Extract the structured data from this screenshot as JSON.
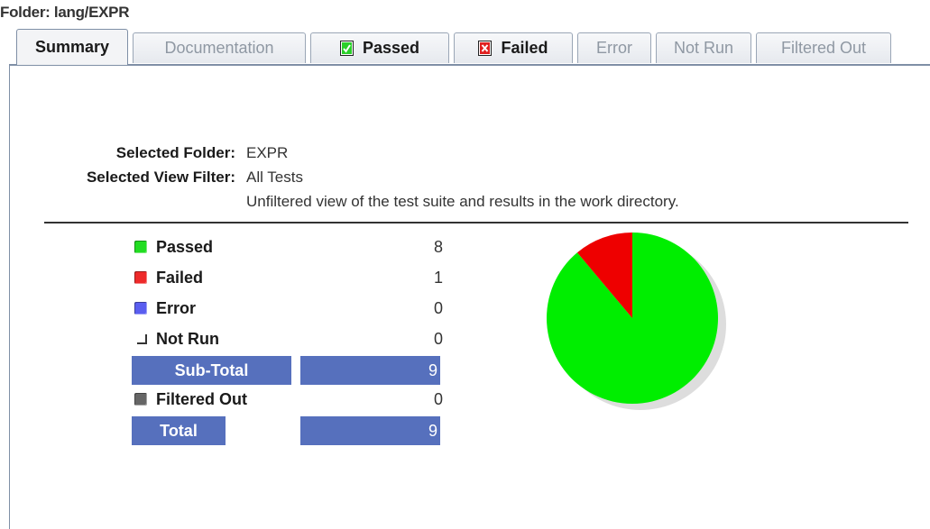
{
  "folder_label": "Folder: lang/EXPR",
  "tabs": [
    {
      "label": "Summary",
      "icon": null,
      "active": true
    },
    {
      "label": "Documentation",
      "icon": null,
      "active": false
    },
    {
      "label": "Passed",
      "icon": "passed-check-icon",
      "active": false
    },
    {
      "label": "Failed",
      "icon": "failed-x-icon",
      "active": false
    },
    {
      "label": "Error",
      "icon": null,
      "active": false
    },
    {
      "label": "Not Run",
      "icon": null,
      "active": false
    },
    {
      "label": "Filtered Out",
      "icon": null,
      "active": false
    }
  ],
  "summary": {
    "selected_folder_label": "Selected Folder:",
    "selected_folder_value": "EXPR",
    "view_filter_label": "Selected View Filter:",
    "view_filter_value": "All Tests",
    "view_filter_description": "Unfiltered view of the test suite and results in the work directory."
  },
  "stats": {
    "passed": {
      "label": "Passed",
      "value": "8",
      "color": "#22dd22"
    },
    "failed": {
      "label": "Failed",
      "value": "1",
      "color": "#ee2a2a"
    },
    "error": {
      "label": "Error",
      "value": "0",
      "color": "#5a5ef0"
    },
    "not_run": {
      "label": "Not Run",
      "value": "0"
    },
    "sub_total": {
      "label": "Sub-Total",
      "value": "9"
    },
    "filtered_out": {
      "label": "Filtered Out",
      "value": "0",
      "color": "#666666"
    },
    "total": {
      "label": "Total",
      "value": "9"
    }
  },
  "colors": {
    "accent_bar": "#5670bd",
    "passed": "#00ee00",
    "failed": "#ee0000"
  },
  "chart_data": {
    "type": "pie",
    "categories": [
      "Passed",
      "Failed",
      "Error",
      "Not Run"
    ],
    "values": [
      8,
      1,
      0,
      0
    ],
    "colors": [
      "#00ee00",
      "#ee0000",
      "#5a5ef0",
      "#cccccc"
    ]
  }
}
